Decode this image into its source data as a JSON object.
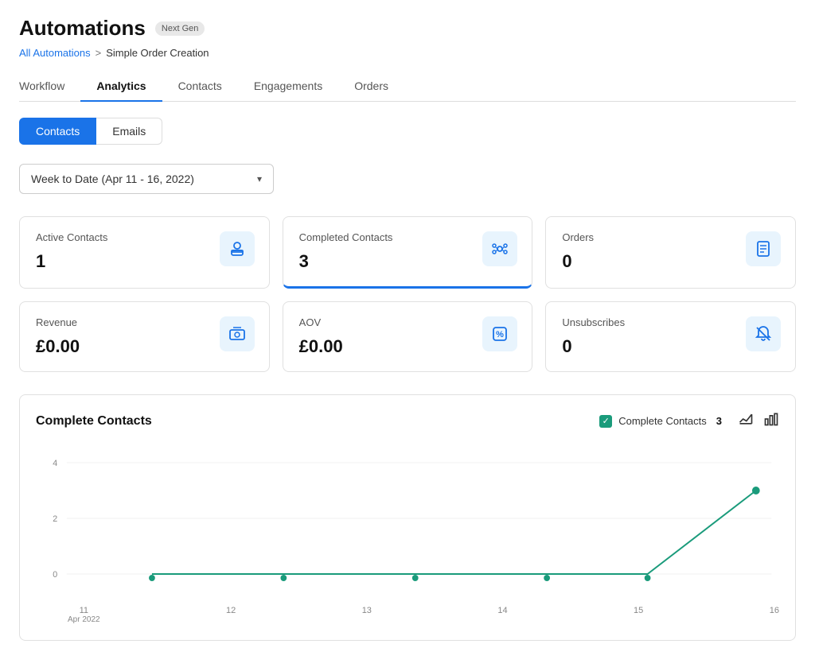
{
  "page": {
    "title": "Automations",
    "badge": "Next Gen"
  },
  "breadcrumb": {
    "link_label": "All Automations",
    "separator": ">",
    "current": "Simple Order Creation"
  },
  "tabs": [
    {
      "label": "Workflow",
      "active": false
    },
    {
      "label": "Analytics",
      "active": true
    },
    {
      "label": "Contacts",
      "active": false
    },
    {
      "label": "Engagements",
      "active": false
    },
    {
      "label": "Orders",
      "active": false
    }
  ],
  "sub_tabs": [
    {
      "label": "Contacts",
      "active": true
    },
    {
      "label": "Emails",
      "active": false
    }
  ],
  "date_filter": {
    "label": "Week to Date (Apr 11 - 16, 2022)",
    "chevron": "▾"
  },
  "metrics": [
    {
      "label": "Active Contacts",
      "value": "1",
      "icon": "person-icon",
      "highlighted": false
    },
    {
      "label": "Completed Contacts",
      "value": "3",
      "icon": "contacts-icon",
      "highlighted": true
    },
    {
      "label": "Orders",
      "value": "0",
      "icon": "orders-icon",
      "highlighted": false
    },
    {
      "label": "Revenue",
      "value": "£0.00",
      "icon": "revenue-icon",
      "highlighted": false
    },
    {
      "label": "AOV",
      "value": "£0.00",
      "icon": "aov-icon",
      "highlighted": false
    },
    {
      "label": "Unsubscribes",
      "value": "0",
      "icon": "bell-off-icon",
      "highlighted": false
    }
  ],
  "chart": {
    "title": "Complete Contacts",
    "legend_label": "Complete Contacts",
    "legend_count": "3",
    "y_labels": [
      "4",
      "2",
      "0"
    ],
    "x_labels": [
      {
        "value": "11\nApr 2022"
      },
      {
        "value": "12"
      },
      {
        "value": "13"
      },
      {
        "value": "14"
      },
      {
        "value": "15"
      },
      {
        "value": "16"
      }
    ]
  }
}
